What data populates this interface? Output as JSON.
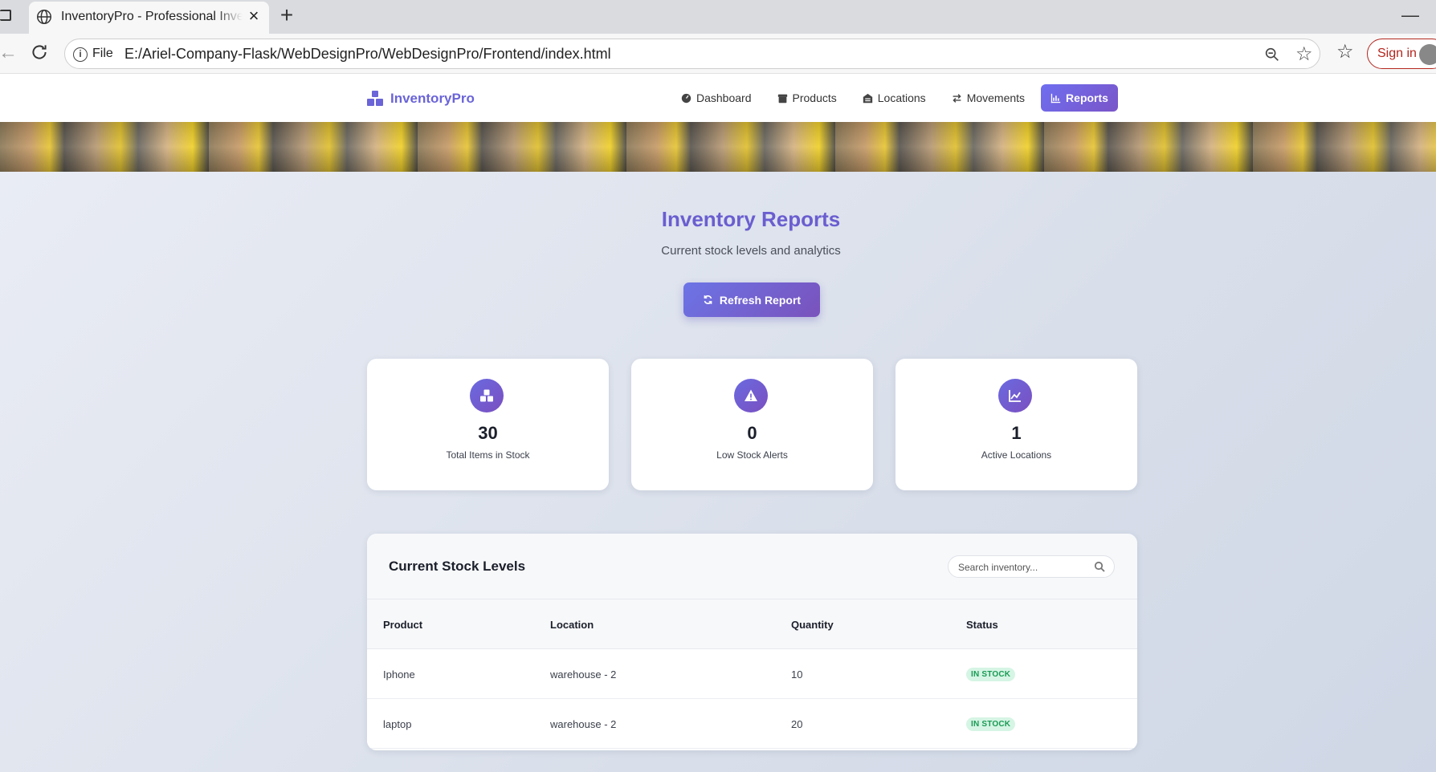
{
  "browser": {
    "tab_title": "InventoryPro - Professional Inventory",
    "new_tab_label": "+",
    "minimize_label": "—",
    "scheme_label": "File",
    "url": "E:/Ariel-Company-Flask/WebDesignPro/WebDesignPro/Frontend/index.html",
    "signin_label": "Sign in"
  },
  "navbar": {
    "brand": "InventoryPro",
    "links": [
      {
        "label": "Dashboard",
        "icon": "dashboard-icon"
      },
      {
        "label": "Products",
        "icon": "box-icon"
      },
      {
        "label": "Locations",
        "icon": "warehouse-icon"
      },
      {
        "label": "Movements",
        "icon": "exchange-icon"
      },
      {
        "label": "Reports",
        "icon": "chart-icon",
        "active": true
      }
    ]
  },
  "page": {
    "title": "Inventory Reports",
    "subtitle": "Current stock levels and analytics",
    "refresh_label": "Refresh Report"
  },
  "stats": [
    {
      "value": "30",
      "label": "Total Items in Stock",
      "icon": "cubes-icon"
    },
    {
      "value": "0",
      "label": "Low Stock Alerts",
      "icon": "warning-icon"
    },
    {
      "value": "1",
      "label": "Active Locations",
      "icon": "chart-line-icon"
    }
  ],
  "stock_table": {
    "title": "Current Stock Levels",
    "search_placeholder": "Search inventory...",
    "columns": [
      "Product",
      "Location",
      "Quantity",
      "Status"
    ],
    "rows": [
      {
        "product": "Iphone",
        "location": "warehouse - 2",
        "quantity": "10",
        "status": "IN STOCK"
      },
      {
        "product": "laptop",
        "location": "warehouse - 2",
        "quantity": "20",
        "status": "IN STOCK"
      }
    ]
  },
  "colors": {
    "accent": "#6a5ed0",
    "brand": "#6a64d8",
    "badge_bg": "#d6f5e4",
    "badge_text": "#1a9a55"
  }
}
